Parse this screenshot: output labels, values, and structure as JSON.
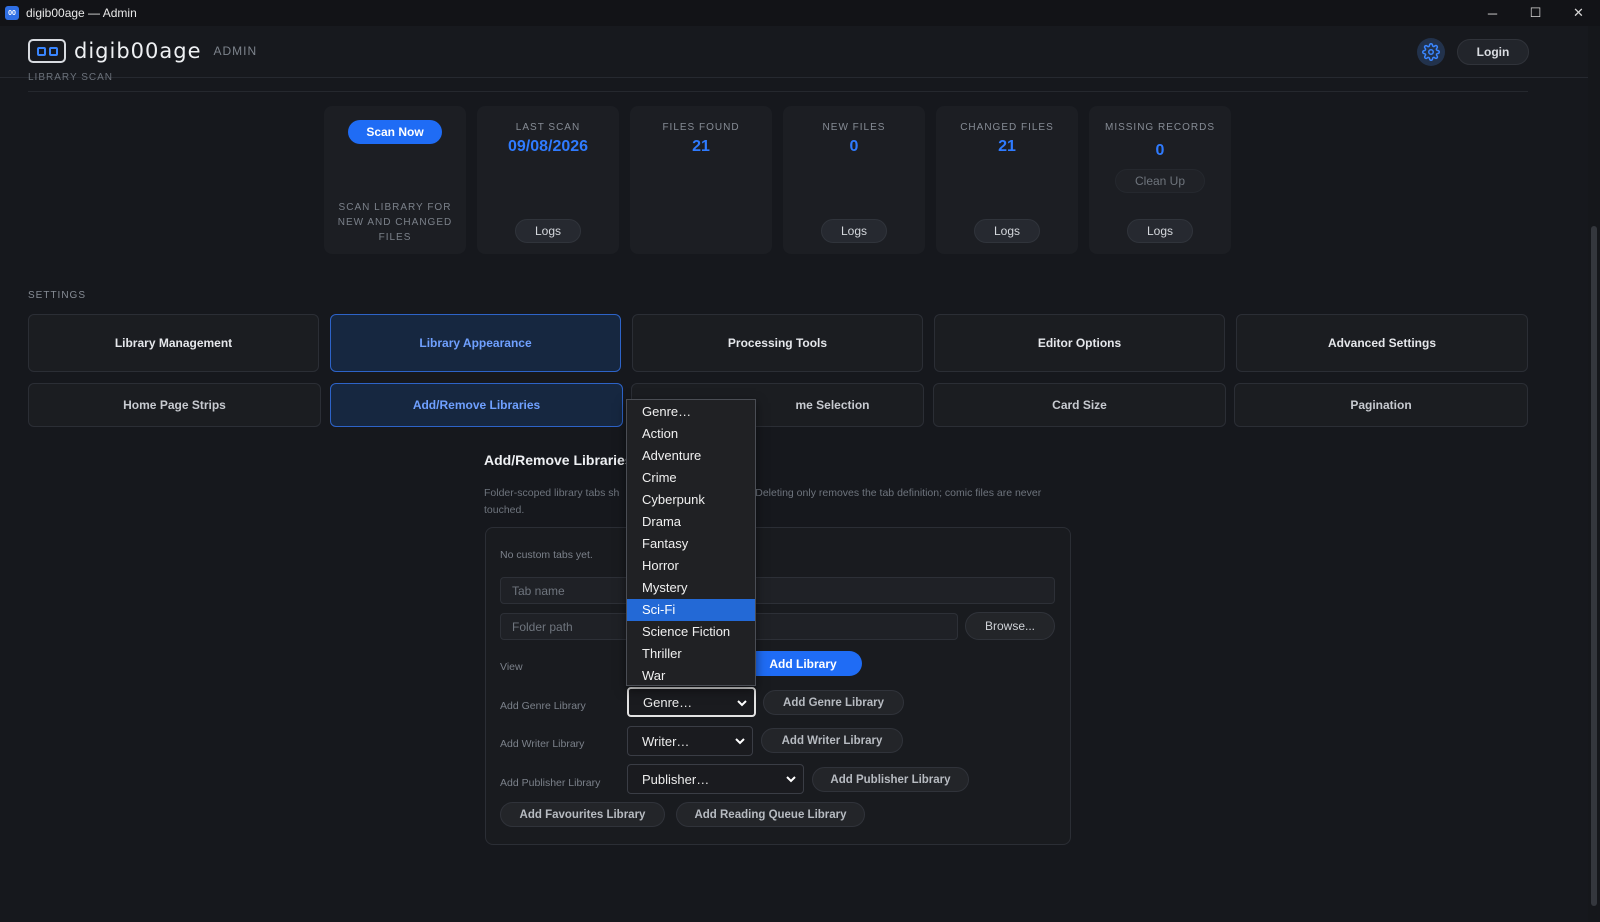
{
  "window": {
    "title": "digib00age — Admin",
    "minimize": "─",
    "maximize": "☐",
    "close": "✕",
    "icon_text": "00"
  },
  "header": {
    "logo_text": "digib00age",
    "admin_label": "ADMIN",
    "login_label": "Login",
    "accent": "#1f6cf5"
  },
  "library_scan": {
    "section_label": "LIBRARY SCAN",
    "scan_now_label": "Scan Now",
    "scan_desc": "SCAN LIBRARY FOR NEW AND CHANGED FILES",
    "cards": [
      {
        "label": "LAST SCAN",
        "value": "09/08/2026",
        "button": "Logs"
      },
      {
        "label": "FILES FOUND",
        "value": "21"
      },
      {
        "label": "NEW FILES",
        "value": "0",
        "button": "Logs"
      },
      {
        "label": "CHANGED FILES",
        "value": "21",
        "button": "Logs"
      },
      {
        "label": "MISSING RECORDS",
        "value": "0",
        "secondary": "Clean Up",
        "button": "Logs"
      }
    ]
  },
  "settings": {
    "section_label": "SETTINGS",
    "row1": [
      "Library Management",
      "Library Appearance",
      "Processing Tools",
      "Editor Options",
      "Advanced Settings"
    ],
    "row2": [
      "Home Page Strips",
      "Add/Remove Libraries",
      "me Selection",
      "Card Size",
      "Pagination"
    ]
  },
  "panel": {
    "title": "Add/Remove Libraries",
    "desc_left": "Folder-scoped library tabs sh",
    "desc_right": ". Deleting only removes the tab definition; comic files are never",
    "desc_line2": "touched.",
    "no_tabs": "No custom tabs yet.",
    "tab_name_placeholder": "Tab name",
    "folder_path_placeholder": "Folder path",
    "browse_label": "Browse...",
    "view_label": "View",
    "add_library_label": "Add Library",
    "genre_row_label": "Add Genre Library",
    "genre_select": "Genre…",
    "add_genre_label": "Add Genre Library",
    "writer_row_label": "Add Writer Library",
    "writer_select": "Writer…",
    "add_writer_label": "Add Writer Library",
    "publisher_row_label": "Add Publisher Library",
    "publisher_select": "Publisher…",
    "add_publisher_label": "Add Publisher Library",
    "add_favourites_label": "Add Favourites Library",
    "add_reading_queue_label": "Add Reading Queue Library"
  },
  "genre_dropdown": {
    "options": [
      "Genre…",
      "Action",
      "Adventure",
      "Crime",
      "Cyberpunk",
      "Drama",
      "Fantasy",
      "Horror",
      "Mystery",
      "Sci-Fi",
      "Science Fiction",
      "Thriller",
      "War"
    ],
    "highlighted": "Sci-Fi"
  }
}
